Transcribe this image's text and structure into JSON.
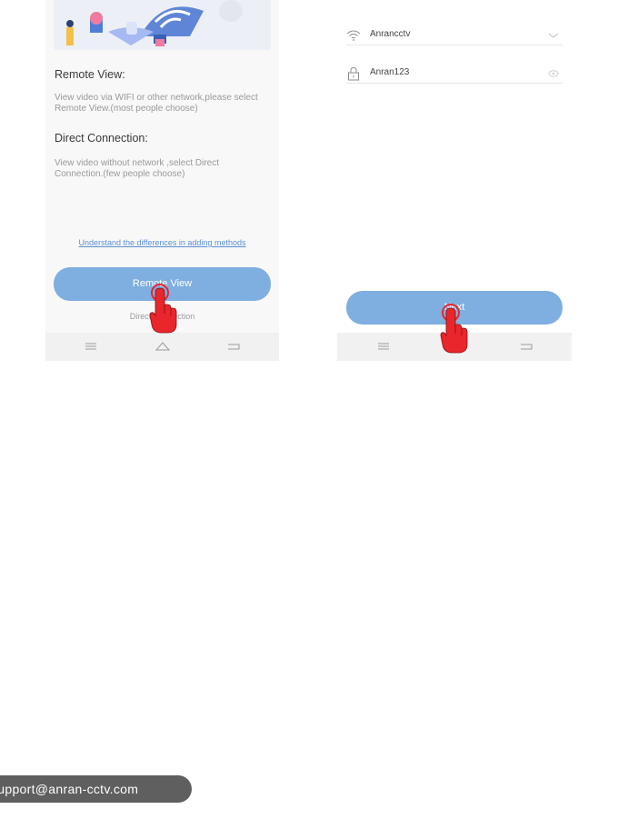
{
  "left_screen": {
    "remote_view_title": "Remote View:",
    "remote_view_desc": "View video via WIFI or other network,please select Remote View.(most people choose)",
    "direct_title": "Direct Connection:",
    "direct_desc": "View video without network ,select Direct Connection.(few people choose)",
    "help_link": "Understand the differences in adding methods",
    "remote_button": "Remote View",
    "direct_link": "Direct Connection"
  },
  "right_screen": {
    "wifi_name": "Anrancctv",
    "password": "Anran123",
    "next_button": "Next"
  },
  "navbar_icons": [
    "menu-icon",
    "home-icon",
    "back-icon"
  ],
  "footer": {
    "email": "support@anran-cctv.com"
  },
  "colors": {
    "button": "#7faee0",
    "link": "#5b8fd3",
    "hand": "#e8262b",
    "badge": "#5f5f5f"
  }
}
